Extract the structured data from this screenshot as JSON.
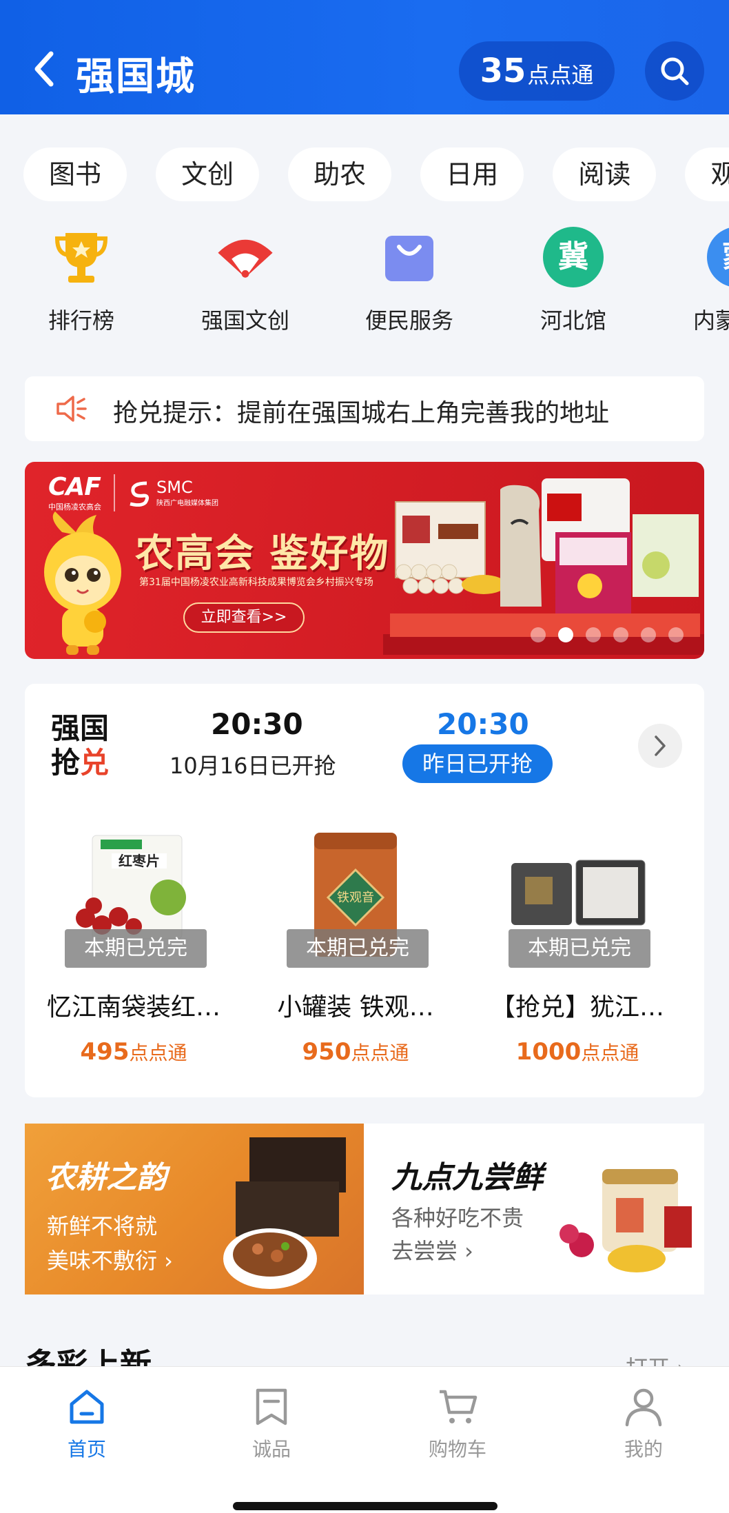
{
  "header": {
    "title": "强国城",
    "points_value": "35",
    "points_unit": "点点通",
    "colors": {
      "brand": "#1a6cf0"
    }
  },
  "chips": [
    "图书",
    "文创",
    "助农",
    "日用",
    "阅读",
    "观影"
  ],
  "icon_row": [
    {
      "label": "排行榜",
      "icon": "trophy-icon"
    },
    {
      "label": "强国文创",
      "icon": "fan-icon"
    },
    {
      "label": "便民服务",
      "icon": "shopping-bag-icon"
    },
    {
      "label": "河北馆",
      "icon": "hebei-badge-icon",
      "glyph": "冀"
    },
    {
      "label": "内蒙古馆",
      "icon": "inner-mongolia-badge-icon",
      "glyph": "蒙"
    }
  ],
  "notice": {
    "text": "抢兑提示：提前在强国城右上角完善我的地址"
  },
  "banner": {
    "logo_caf": "CAF",
    "logo_caf_sub": "中国杨凌农高会",
    "logo_smc": "SMC",
    "logo_smc_sub": "陕西广电融媒体集团",
    "title": "农高会 鉴好物",
    "subtitle": "第31届中国杨凌农业高新科技成果博览会乡村振兴专场",
    "button": "立即查看>>",
    "slide_count": 6,
    "active_slide": 1
  },
  "flash_sale": {
    "logo_line1": "强国",
    "logo_line2_a": "抢",
    "logo_line2_b": "兑",
    "slot1": {
      "time": "20:30",
      "label": "10月16日已开抢"
    },
    "slot2": {
      "time": "20:30",
      "label": "昨日已开抢"
    },
    "products": [
      {
        "name": "忆江南袋装红…",
        "price": "495",
        "unit": "点点通",
        "badge": "本期已兑完"
      },
      {
        "name": "小罐装  铁观…",
        "price": "950",
        "unit": "点点通",
        "badge": "本期已兑完"
      },
      {
        "name": "【抢兑】犹江…",
        "price": "1000",
        "unit": "点点通",
        "badge": "本期已兑完"
      }
    ]
  },
  "promos": {
    "left": {
      "title": "农耕之韵",
      "line1": "新鲜不将就",
      "line2": "美味不敷衍 ›"
    },
    "right": {
      "title": "九点九尝鲜",
      "line1": "各种好吃不贵",
      "line2": "去尝尝 ›"
    }
  },
  "section": {
    "title": "多彩上新",
    "more": "打开 ›"
  },
  "tabbar": [
    {
      "label": "首页",
      "icon": "home-icon",
      "active": true
    },
    {
      "label": "诚品",
      "icon": "bookmark-icon",
      "active": false
    },
    {
      "label": "购物车",
      "icon": "cart-icon",
      "active": false
    },
    {
      "label": "我的",
      "icon": "person-icon",
      "active": false
    }
  ]
}
